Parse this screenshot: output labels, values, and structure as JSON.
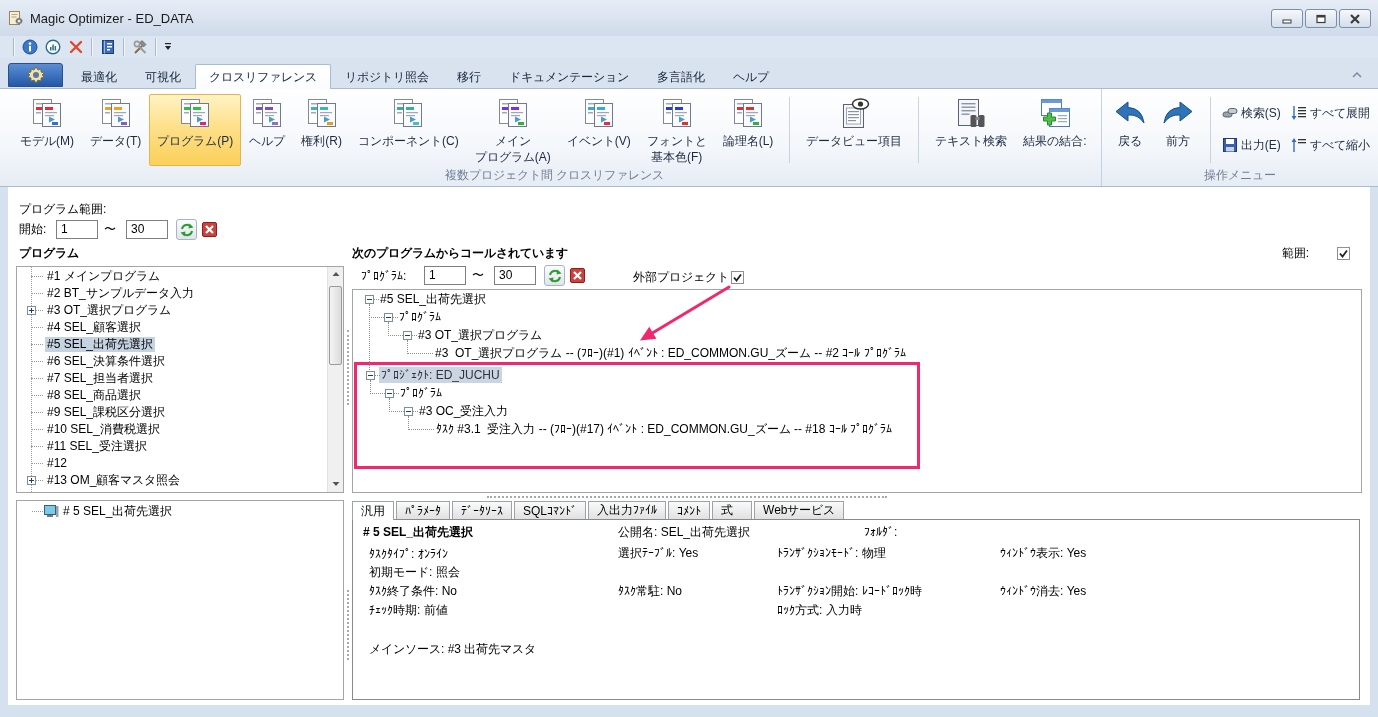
{
  "window": {
    "title": "Magic Optimizer - ED_DATA"
  },
  "ribbon": {
    "tabs": [
      {
        "label": "最適化",
        "selected": false
      },
      {
        "label": "可視化",
        "selected": false
      },
      {
        "label": "クロスリファレンス",
        "selected": true
      },
      {
        "label": "リポジトリ照会",
        "selected": false
      },
      {
        "label": "移行",
        "selected": false
      },
      {
        "label": "ドキュメンテーション",
        "selected": false
      },
      {
        "label": "多言語化",
        "selected": false
      },
      {
        "label": "ヘルプ",
        "selected": false
      }
    ],
    "groups": [
      {
        "label": "複数プロジェクト間 クロスリファレンス",
        "buttons": [
          {
            "kind": "document",
            "label": "モデル(M)",
            "selected": false
          },
          {
            "kind": "document",
            "label": "データ(T)",
            "selected": false
          },
          {
            "kind": "document",
            "label": "プログラム(P)",
            "selected": true
          },
          {
            "kind": "document",
            "label": "ヘルプ",
            "selected": false
          },
          {
            "kind": "document",
            "label": "権利(R)",
            "selected": false
          },
          {
            "kind": "document",
            "label": "コンポーネント(C)",
            "selected": false
          },
          {
            "kind": "document",
            "label": [
              "メイン",
              "プログラム(A)"
            ],
            "selected": false
          },
          {
            "kind": "document",
            "label": "イベント(V)",
            "selected": false
          },
          {
            "kind": "document",
            "label": [
              "フォントと",
              "基本色(F)"
            ],
            "selected": false
          },
          {
            "kind": "document",
            "label": "論理名(L)",
            "selected": false
          },
          {
            "kind": "separator"
          },
          {
            "kind": "dataview",
            "label": "データビュー項目",
            "selected": false
          },
          {
            "kind": "separator"
          },
          {
            "kind": "textsearch",
            "label": "テキスト検索",
            "selected": false
          },
          {
            "kind": "merge",
            "label": "結果の結合:",
            "selected": false
          }
        ]
      },
      {
        "label": "操作メニュー",
        "buttons": [
          {
            "kind": "back",
            "label": "戻る",
            "selected": false
          },
          {
            "kind": "forward",
            "label": "前方",
            "selected": false
          },
          {
            "kind": "separator"
          },
          {
            "kind": "find",
            "label": "検索(S)",
            "selected": false
          },
          {
            "kind": "save",
            "label": "出力(E)",
            "selected": false
          },
          {
            "kind": "expand",
            "label": "すべて展開",
            "selected": false
          },
          {
            "kind": "collapse",
            "label": "すべて縮小",
            "selected": false
          }
        ]
      }
    ]
  },
  "range": {
    "title": "プログラム範囲:",
    "start_label": "開始:",
    "from": "1",
    "separator": "〜",
    "to": "30"
  },
  "programs": {
    "title": "プログラム",
    "items": [
      {
        "label": "#1 メインプログラム",
        "expandable": false,
        "selected": false
      },
      {
        "label": "#2 BT_サンプルデータ入力",
        "expandable": false,
        "selected": false
      },
      {
        "label": "#3 OT_選択プログラム",
        "expandable": true,
        "selected": false
      },
      {
        "label": "#4 SEL_顧客選択",
        "expandable": false,
        "selected": false
      },
      {
        "label": "#5 SEL_出荷先選択",
        "expandable": false,
        "selected": true
      },
      {
        "label": "#6 SEL_決算条件選択",
        "expandable": false,
        "selected": false
      },
      {
        "label": "#7 SEL_担当者選択",
        "expandable": false,
        "selected": false
      },
      {
        "label": "#8 SEL_商品選択",
        "expandable": false,
        "selected": false
      },
      {
        "label": "#9 SEL_課税区分選択",
        "expandable": false,
        "selected": false
      },
      {
        "label": "#10 SEL_消費税選択",
        "expandable": false,
        "selected": false
      },
      {
        "label": "#11 SEL_受注選択",
        "expandable": false,
        "selected": false
      },
      {
        "label": "#12",
        "expandable": false,
        "selected": false
      },
      {
        "label": "#13 OM_顧客マスタ照会",
        "expandable": true,
        "selected": false
      }
    ]
  },
  "current_program": {
    "label": "# 5 SEL_出荷先選択"
  },
  "callers": {
    "title": "次のプログラムからコールされています",
    "range_label": "範囲:",
    "range_checked": true,
    "program_label": "ﾌﾟﾛｸﾞﾗﾑ:",
    "from": "1",
    "separator": "〜",
    "to": "30",
    "external_project": {
      "label": "外部プロジェクト",
      "checked": true,
      "annotated": true
    },
    "tree": [
      {
        "label": "#5 SEL_出荷先選択",
        "expanded": true,
        "selected": false,
        "children": [
          {
            "label": "ﾌﾟﾛｸﾞﾗﾑ",
            "expanded": true,
            "selected": false,
            "children": [
              {
                "label": "#3 OT_選択プログラム",
                "expanded": true,
                "selected": false,
                "children": [
                  {
                    "label": "#3  OT_選択プログラム -- (ﾌﾛｰ)(#1) ｲﾍﾞﾝﾄ : ED_COMMON.GU_ズーム -- #2 ｺｰﾙ ﾌﾟﾛｸﾞﾗﾑ",
                    "selected": false
                  }
                ]
              }
            ]
          }
        ]
      },
      {
        "label": "ﾌﾟﾛｼﾞｪｸﾄ: ED_JUCHU",
        "expanded": true,
        "selected": true,
        "outlined": true,
        "children": [
          {
            "label": "ﾌﾟﾛｸﾞﾗﾑ",
            "expanded": true,
            "selected": false,
            "children": [
              {
                "label": "#3 OC_受注入力",
                "expanded": true,
                "selected": false,
                "children": [
                  {
                    "label": "ﾀｽｸ #3.1  受注入力 -- (ﾌﾛｰ)(#17) ｲﾍﾞﾝﾄ : ED_COMMON.GU_ズーム -- #18 ｺｰﾙ ﾌﾟﾛｸﾞﾗﾑ",
                    "selected": false
                  }
                ]
              }
            ]
          }
        ]
      }
    ]
  },
  "detail_tabs": [
    {
      "label": "汎用",
      "selected": true
    },
    {
      "label": "ﾊﾟﾗﾒｰﾀ",
      "selected": false
    },
    {
      "label": "ﾃﾞｰﾀｿｰｽ",
      "selected": false
    },
    {
      "label": "SQLｺﾏﾝﾄﾞ",
      "selected": false
    },
    {
      "label": "入出力ﾌｧｲﾙ",
      "selected": false
    },
    {
      "label": "ｺﾒﾝﾄ",
      "selected": false
    },
    {
      "label": "式",
      "selected": false
    },
    {
      "label": "Webサービス",
      "selected": false
    }
  ],
  "details": {
    "title": "# 5 SEL_出荷先選択",
    "public_name": "公開名: SEL_出荷先選択",
    "folder": "ﾌｫﾙﾀﾞ:",
    "rows": [
      {
        "column_1": "ﾀｽｸﾀｲﾌﾟ: ｵﾝﾗｲﾝ",
        "column_2": "選択ﾃｰﾌﾞﾙ: Yes",
        "column_3": "ﾄﾗﾝｻﾞｸｼｮﾝﾓｰﾄﾞ: 物理",
        "column_4": "ｳｨﾝﾄﾞｳ表示: Yes"
      },
      {
        "column_1": "初期モード: 照会"
      },
      {
        "column_1": "ﾀｽｸ終了条件: No",
        "column_2": "ﾀｽｸ常駐: No",
        "column_3": "ﾄﾗﾝｻﾞｸｼｮﾝ開始: ﾚｺｰﾄﾞﾛｯｸ時",
        "column_4": "ｳｨﾝﾄﾞｳ消去: Yes"
      },
      {
        "column_1": "ﾁｪｯｸ時期: 前値",
        "column_3": "ﾛｯｸ方式: 入力時"
      }
    ],
    "main_source": "メインソース: #3 出荷先マスタ"
  }
}
